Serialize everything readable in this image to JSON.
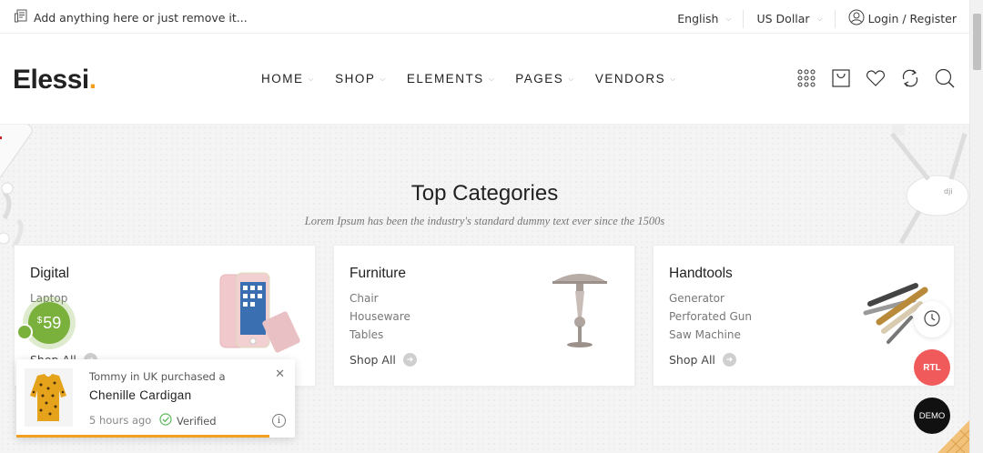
{
  "topbar": {
    "notice": "Add anything here or just remove it...",
    "language": "English",
    "currency": "US Dollar",
    "account": "Login / Register"
  },
  "header": {
    "logo_text": "Elessi",
    "logo_dot": ".",
    "nav": [
      {
        "label": "HOME"
      },
      {
        "label": "SHOP"
      },
      {
        "label": "ELEMENTS"
      },
      {
        "label": "PAGES"
      },
      {
        "label": "VENDORS"
      }
    ],
    "icons": [
      "grid-icon",
      "cart-icon",
      "heart-icon",
      "compare-icon",
      "search-icon"
    ]
  },
  "section": {
    "title": "Top Categories",
    "subtitle": "Lorem Ipsum has been the industry's standard dummy text ever since the 1500s"
  },
  "categories": [
    {
      "name": "Digital",
      "items": [
        "Laptop",
        "",
        ""
      ],
      "shop_all": "Shop All"
    },
    {
      "name": "Furniture",
      "items": [
        "Chair",
        "Houseware",
        "Tables"
      ],
      "shop_all": "Shop All"
    },
    {
      "name": "Handtools",
      "items": [
        "Generator",
        "Perforated Gun",
        "Saw Machine"
      ],
      "shop_all": "Shop All"
    }
  ],
  "price_badge": {
    "currency": "$",
    "amount": "59"
  },
  "purchase_popup": {
    "who": "Tommy in UK purchased a",
    "product": "Chenille Cardigan",
    "time": "5 hours ago",
    "verified": "Verified",
    "close": "✕",
    "info": "i",
    "progress": 0.91
  },
  "floating": {
    "rtl": "RTL",
    "demo": "DEMO"
  },
  "colors": {
    "accent": "#f0a01e",
    "badge_green": "#7ab03c",
    "rtl_red": "#f05a5a",
    "demo_black": "#111111"
  }
}
